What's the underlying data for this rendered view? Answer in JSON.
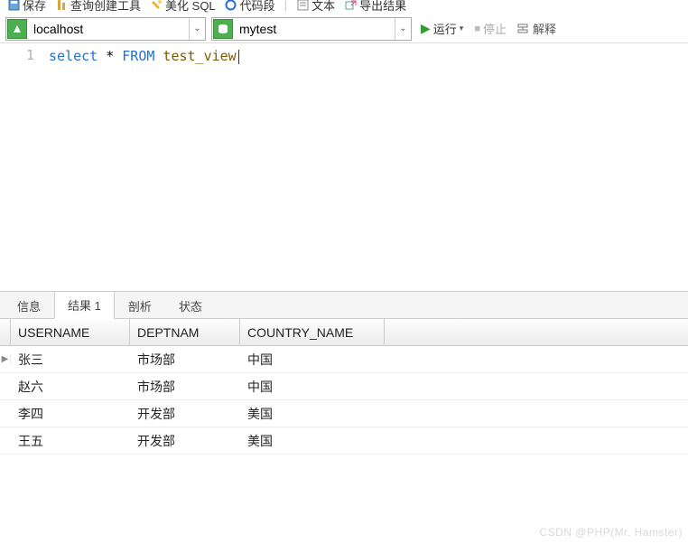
{
  "toolbar_top": {
    "save": "保存",
    "query_builder": "查询创建工具",
    "beautify_sql": "美化 SQL",
    "code_snippet": "代码段",
    "text": "文本",
    "export_results": "导出结果"
  },
  "connection": {
    "host": "localhost",
    "schema": "mytest"
  },
  "actions": {
    "run": "运行",
    "stop": "停止",
    "explain": "解释"
  },
  "editor": {
    "line_numbers": [
      "1"
    ],
    "sql_keyword1": "select",
    "sql_star": " * ",
    "sql_keyword2": "FROM",
    "sql_table": " test_view"
  },
  "tabs": {
    "info": "信息",
    "result1": "结果 1",
    "profile": "剖析",
    "status": "状态"
  },
  "grid": {
    "columns": {
      "username": "USERNAME",
      "deptnam": "DEPTNAM",
      "country_name": "COUNTRY_NAME"
    },
    "rows": [
      {
        "username": "张三",
        "deptnam": "市场部",
        "country": "中国"
      },
      {
        "username": "赵六",
        "deptnam": "市场部",
        "country": "中国"
      },
      {
        "username": "李四",
        "deptnam": "开发部",
        "country": "美国"
      },
      {
        "username": "王五",
        "deptnam": "开发部",
        "country": "美国"
      }
    ]
  },
  "watermark": "CSDN @PHP(Mr. Hamster)"
}
